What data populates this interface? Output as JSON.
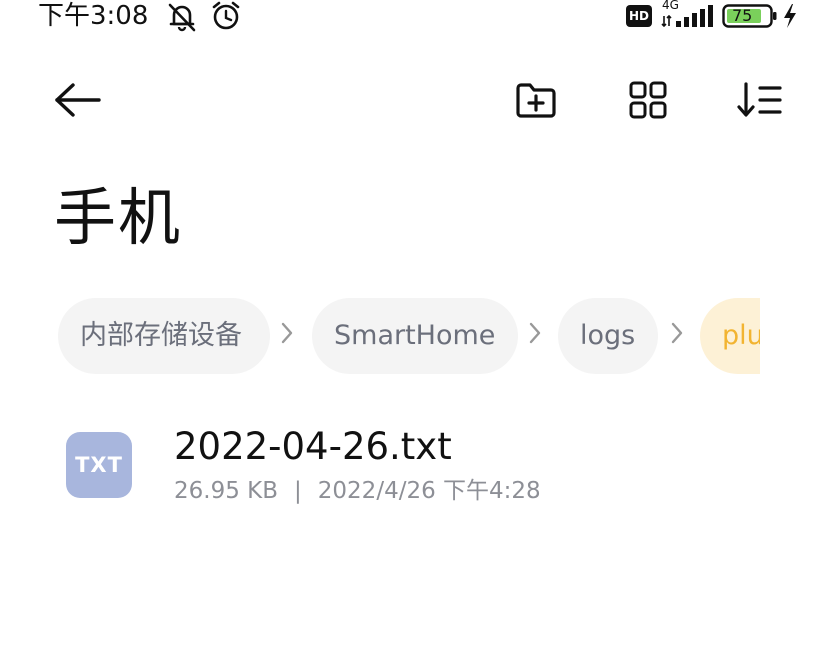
{
  "status_bar": {
    "time": "下午3:08",
    "icons": [
      "muted-bell-icon",
      "alarm-icon",
      "hd-icon",
      "signal-4g-icon",
      "battery-icon",
      "charging-icon"
    ],
    "hd_label": "HD",
    "network": "4G",
    "battery": "75",
    "battery_color": "#7ad05b"
  },
  "toolbar": {
    "icons": [
      "back-arrow-icon",
      "new-folder-icon",
      "grid-view-icon",
      "sort-icon"
    ]
  },
  "page": {
    "title": "手机"
  },
  "breadcrumb": {
    "items": [
      {
        "label": "内部存储设备"
      },
      {
        "label": "SmartHome"
      },
      {
        "label": "logs"
      },
      {
        "label": "plu"
      }
    ],
    "active_color": "#f2b431"
  },
  "files": [
    {
      "icon_label": "TXT",
      "name": "2022-04-26.txt",
      "size": "26.95 KB",
      "separator": "|",
      "date": "2022/4/26 下午4:28"
    }
  ]
}
